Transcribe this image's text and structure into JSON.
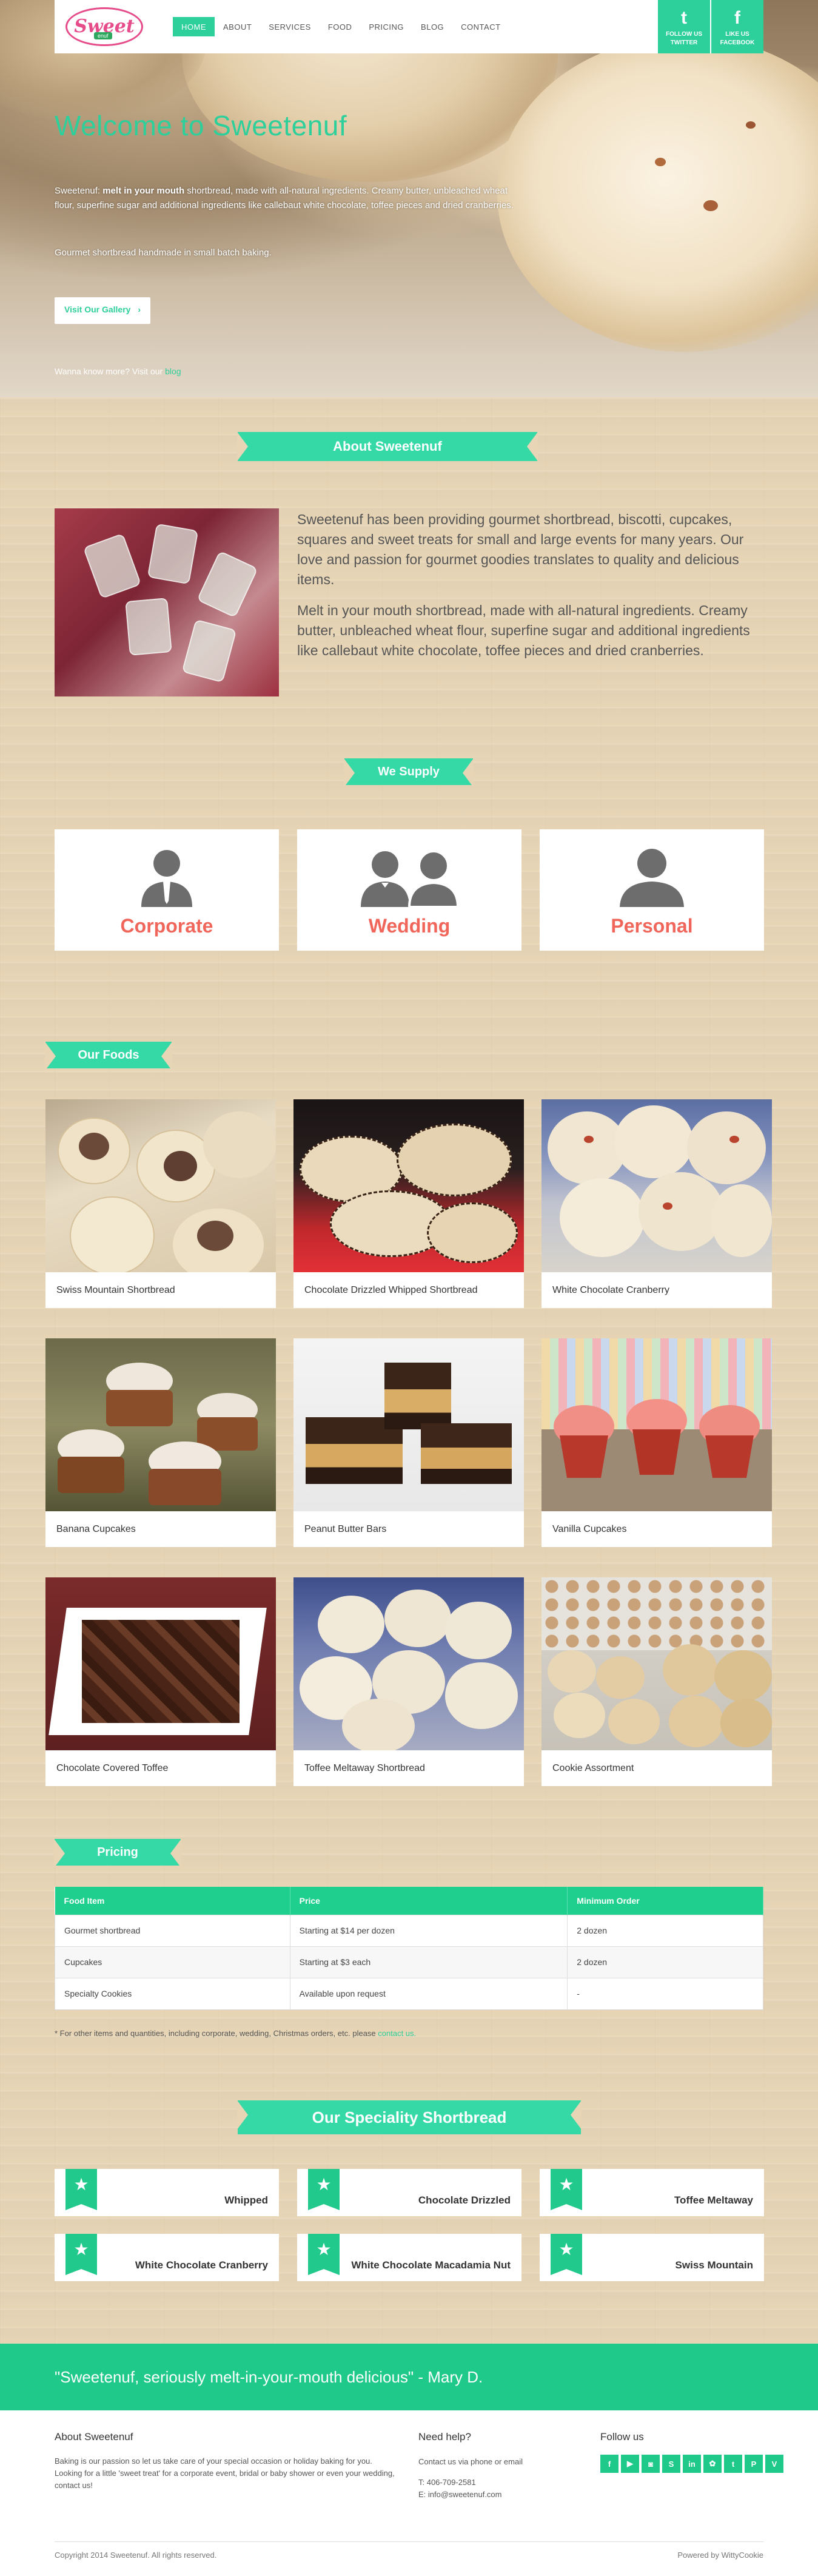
{
  "header": {
    "logo_text": "Sweet",
    "logo_sub": "enuf",
    "nav": [
      "HOME",
      "ABOUT",
      "SERVICES",
      "FOOD",
      "PRICING",
      "BLOG",
      "CONTACT"
    ],
    "twitter_label": "FOLLOW US TWITTER",
    "facebook_label": "LIKE US FACEBOOK",
    "twitter_icon": "t",
    "facebook_icon": "f"
  },
  "hero": {
    "title": "Welcome to Sweetenuf",
    "intro_bold": "melt in your mouth",
    "intro_pre": "Sweetenuf: ",
    "intro_post": " shortbread, made with all-natural ingredients. Creamy butter, unbleached wheat flour, superfine sugar and additional ingredients like callebaut white chocolate, toffee pieces and dried cranberries.",
    "tagline": "Gourmet shortbread handmade in small batch baking.",
    "gallery_button": "Visit Our Gallery",
    "more_prefix": "Wanna know more? Visit our ",
    "more_link": "blog"
  },
  "about": {
    "heading": "About Sweetenuf",
    "p1": "Sweetenuf has been providing gourmet shortbread, biscotti, cupcakes, squares and sweet treats for small and large events for many years. Our love and passion for gourmet goodies translates to quality and delicious items.",
    "p2": "Melt in your mouth shortbread, made with all-natural ingredients. Creamy butter, unbleached wheat flour, superfine sugar and additional ingredients like callebaut white chocolate, toffee pieces and dried cranberries."
  },
  "supply": {
    "heading": "We Supply",
    "items": [
      "Corporate",
      "Wedding",
      "Personal"
    ]
  },
  "foods": {
    "heading": "Our Foods",
    "items": [
      "Swiss Mountain Shortbread",
      "Chocolate Drizzled Whipped Shortbread",
      "White Chocolate Cranberry",
      "Banana Cupcakes",
      "Peanut Butter Bars",
      "Vanilla Cupcakes",
      "Chocolate Covered Toffee",
      "Toffee Meltaway Shortbread",
      "Cookie Assortment"
    ]
  },
  "pricing": {
    "heading": "Pricing",
    "columns": [
      "Food Item",
      "Price",
      "Minimum Order"
    ],
    "rows": [
      [
        "Gourmet shortbread",
        "Starting at $14 per dozen",
        "2 dozen"
      ],
      [
        "Cupcakes",
        "Starting at $3 each",
        "2 dozen"
      ],
      [
        "Specialty Cookies",
        "Available upon request",
        "-"
      ]
    ],
    "note_prefix": "* For other items and quantities, including corporate, wedding, Christmas orders, etc. please ",
    "note_link": "contact us."
  },
  "speciality": {
    "heading": "Our Speciality Shortbread",
    "items": [
      "Whipped",
      "Chocolate Drizzled",
      "Toffee Meltaway",
      "White Chocolate Cranberry",
      "White Chocolate Macadamia Nut",
      "Swiss Mountain"
    ]
  },
  "testimonial": "\"Sweetenuf, seriously melt-in-your-mouth delicious\" - Mary D.",
  "footer": {
    "about_heading": "About Sweetenuf",
    "about_text": "Baking is our passion so let us take care of your special occasion or holiday baking for you. Looking for a little 'sweet treat' for a corporate event, bridal or baby shower or even your wedding, contact us!",
    "help_heading": "Need help?",
    "help_text": "Contact us via phone or email",
    "phone": "T: 406-709-2581",
    "email": "E: info@sweetenuf.com",
    "follow_heading": "Follow us",
    "social_icons": [
      "f",
      "▶",
      "◙",
      "S",
      "in",
      "✿",
      "t",
      "P",
      "V"
    ],
    "copyright": "Copyright 2014 Sweetenuf. All rights reserved.",
    "powered": "Powered by WittyCookie"
  },
  "colors": {
    "accent": "#2dcf9a",
    "coral": "#f1665b",
    "pink": "#e64b8a"
  }
}
